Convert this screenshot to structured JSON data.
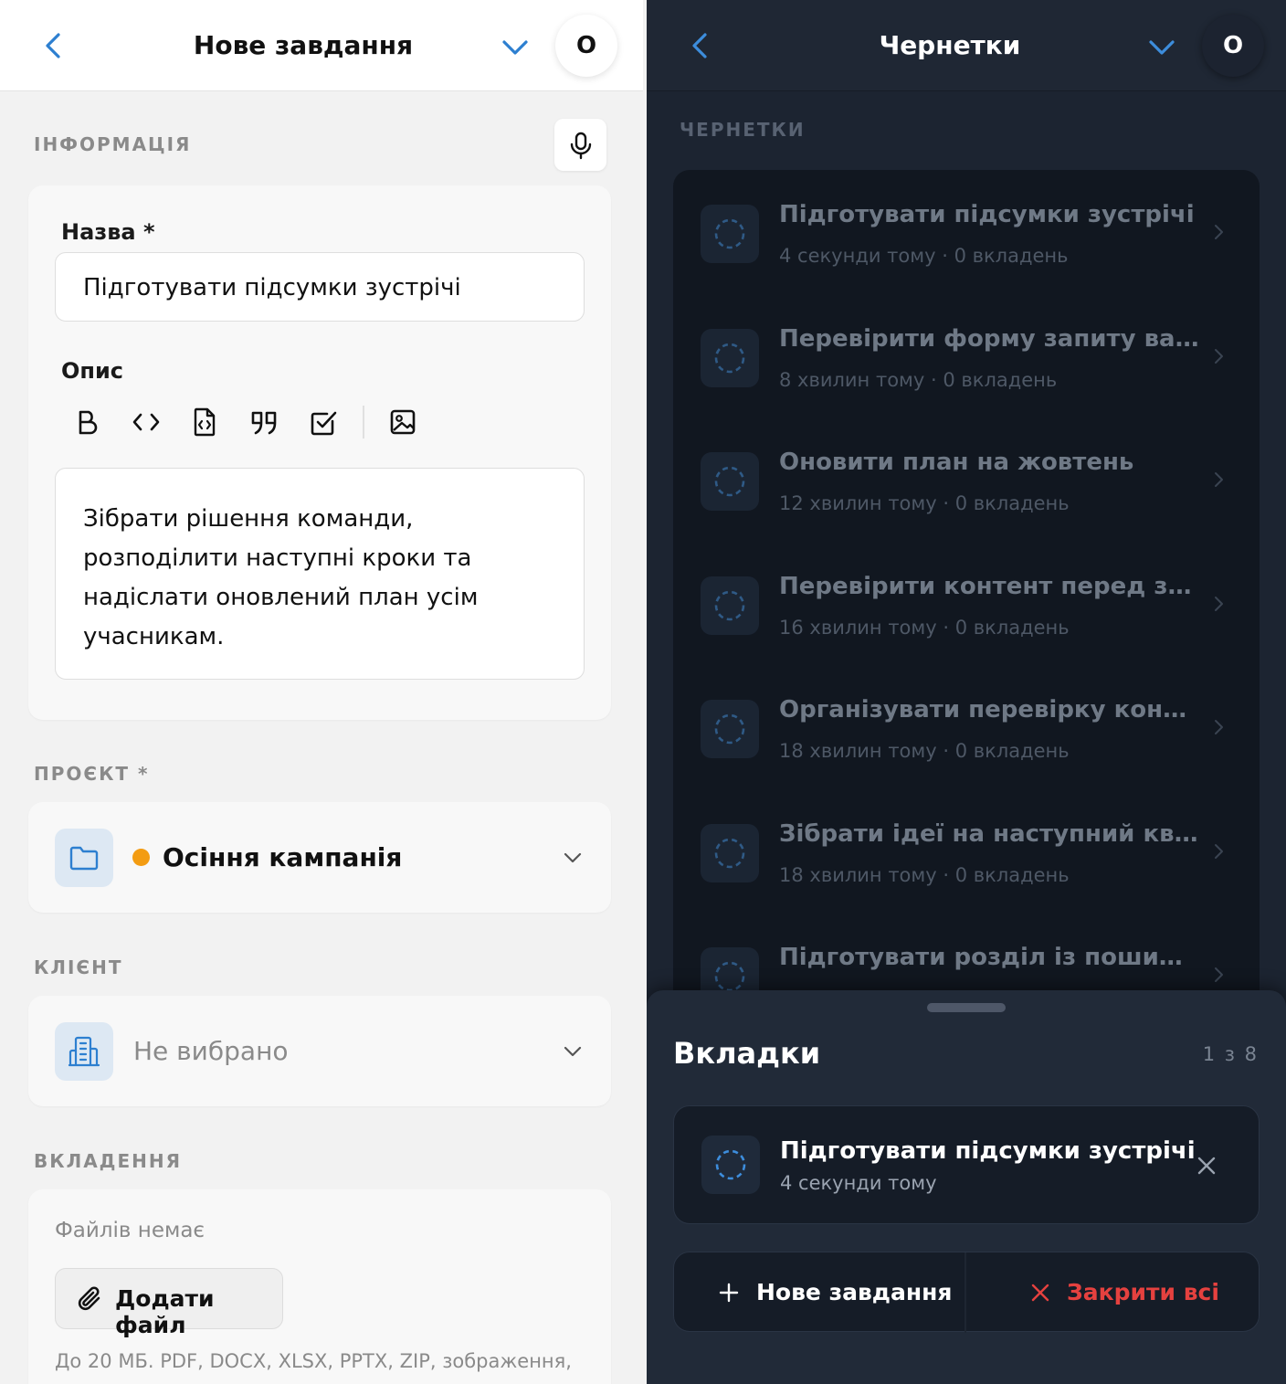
{
  "left": {
    "header": {
      "title": "Нове завдання",
      "avatar": "O"
    },
    "info_section": {
      "title": "ІНФОРМАЦІЯ"
    },
    "name_field": {
      "label": "Назва *",
      "value": "Підготувати підсумки зустрічі"
    },
    "description": {
      "label": "Опис",
      "toolbar": [
        "bold-icon",
        "code-icon",
        "code-file-icon",
        "quote-icon",
        "checkbox-icon",
        "image-icon"
      ],
      "lines": [
        "Зібрати рішення команди,",
        "розподілити наступні кроки та",
        "надіслати оновлений план усім",
        "учасникам."
      ]
    },
    "project": {
      "section_title": "ПРОЄКТ *",
      "value": "Осіння кампанія",
      "dot_color": "#f39c12",
      "icon": "folder-icon"
    },
    "client": {
      "section_title": "КЛІЄНТ",
      "value": "Не вибрано",
      "icon": "building-icon"
    },
    "attachments": {
      "section_title": "ВКЛАДЕННЯ",
      "empty_text": "Файлів немає",
      "add_button": "Додати файл",
      "hint": "До 20 МБ. PDF, DOCX, XLSX, PPTX, ZIP, зображення,"
    }
  },
  "right": {
    "header": {
      "title": "Чернетки",
      "avatar": "O"
    },
    "section_title": "ЧЕРНЕТКИ",
    "drafts": [
      {
        "title": "Підготувати підсумки зустрічі",
        "time": "4 секунди тому",
        "attachments": "0 вкладень"
      },
      {
        "title": "Перевірити форму запиту варт...",
        "time": "8 хвилин тому",
        "attachments": "0 вкладень"
      },
      {
        "title": "Оновити план на жовтень",
        "time": "12 хвилин тому",
        "attachments": "0 вкладень"
      },
      {
        "title": "Перевірити контент перед запу...",
        "time": "16 хвилин тому",
        "attachments": "0 вкладень"
      },
      {
        "title": "Організувати перевірку контенту",
        "time": "18 хвилин тому",
        "attachments": "0 вкладень"
      },
      {
        "title": "Зібрати ідеї на наступний кварт...",
        "time": "18 хвилин тому",
        "attachments": "0 вкладень"
      },
      {
        "title": "Підготувати розділ із поширени...",
        "time": "",
        "attachments": ""
      }
    ],
    "sheet": {
      "title": "Вкладки",
      "count": "1 з 8",
      "tab": {
        "title": "Підготувати підсумки зустрічі",
        "time": "4 секунди тому"
      },
      "new_button": "Нове завдання",
      "close_all_button": "Закрити всі"
    }
  },
  "colors": {
    "accent": "#2d7fd0",
    "danger": "#e5413f",
    "dark_bg": "#1c2431"
  }
}
